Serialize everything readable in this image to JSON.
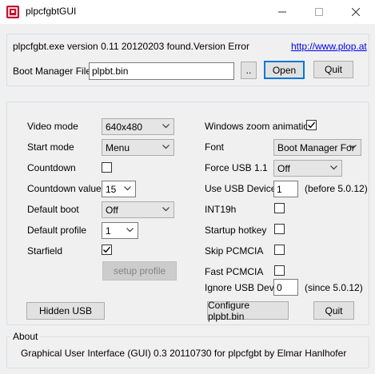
{
  "window": {
    "title": "plpcfgbtGUI",
    "minimize_glyph": "—",
    "close_glyph": "✕"
  },
  "top": {
    "version_text": "plpcfgbt.exe version 0.11 20120203 found.Version Error",
    "link_text": "http://www.plop.at",
    "boot_manager_label": "Boot Manager File",
    "boot_manager_value": "plpbt.bin",
    "browse_label": "..",
    "open_label": "Open",
    "quit_label": "Quit"
  },
  "left": {
    "video_mode_label": "Video mode",
    "video_mode_value": "640x480",
    "start_mode_label": "Start mode",
    "start_mode_value": "Menu",
    "countdown_label": "Countdown",
    "countdown_checked": false,
    "countdown_value_label": "Countdown value",
    "countdown_value": "15",
    "default_boot_label": "Default boot",
    "default_boot_value": "Off",
    "default_profile_label": "Default profile",
    "default_profile_value": "1",
    "starfield_label": "Starfield",
    "starfield_checked": true,
    "setup_profile_label": "setup profile",
    "hidden_usb_label": "Hidden USB"
  },
  "right": {
    "zoom_label": "Windows zoom animation",
    "zoom_checked": true,
    "font_label": "Font",
    "font_value": "Boot Manager For",
    "force_usb_label": "Force USB 1.1",
    "force_usb_value": "Off",
    "use_usb_device_label": "Use USB Device",
    "use_usb_device_value": "1",
    "use_usb_device_note": "(before 5.0.12)",
    "int19h_label": "INT19h",
    "startup_hotkey_label": "Startup hotkey",
    "skip_pcmcia_label": "Skip PCMCIA",
    "fast_pcmcia_label": "Fast PCMCIA",
    "ignore_usb_devs_label": "Ignore USB Devs",
    "ignore_usb_devs_value": "0",
    "ignore_usb_devs_note": "(since 5.0.12)",
    "configure_label": "Configure plpbt.bin",
    "quit_label": "Quit"
  },
  "about": {
    "legend": "About",
    "text": "Graphical User Interface (GUI) 0.3 20110730 for plpcfgbt by Elmar Hanlhofer"
  }
}
